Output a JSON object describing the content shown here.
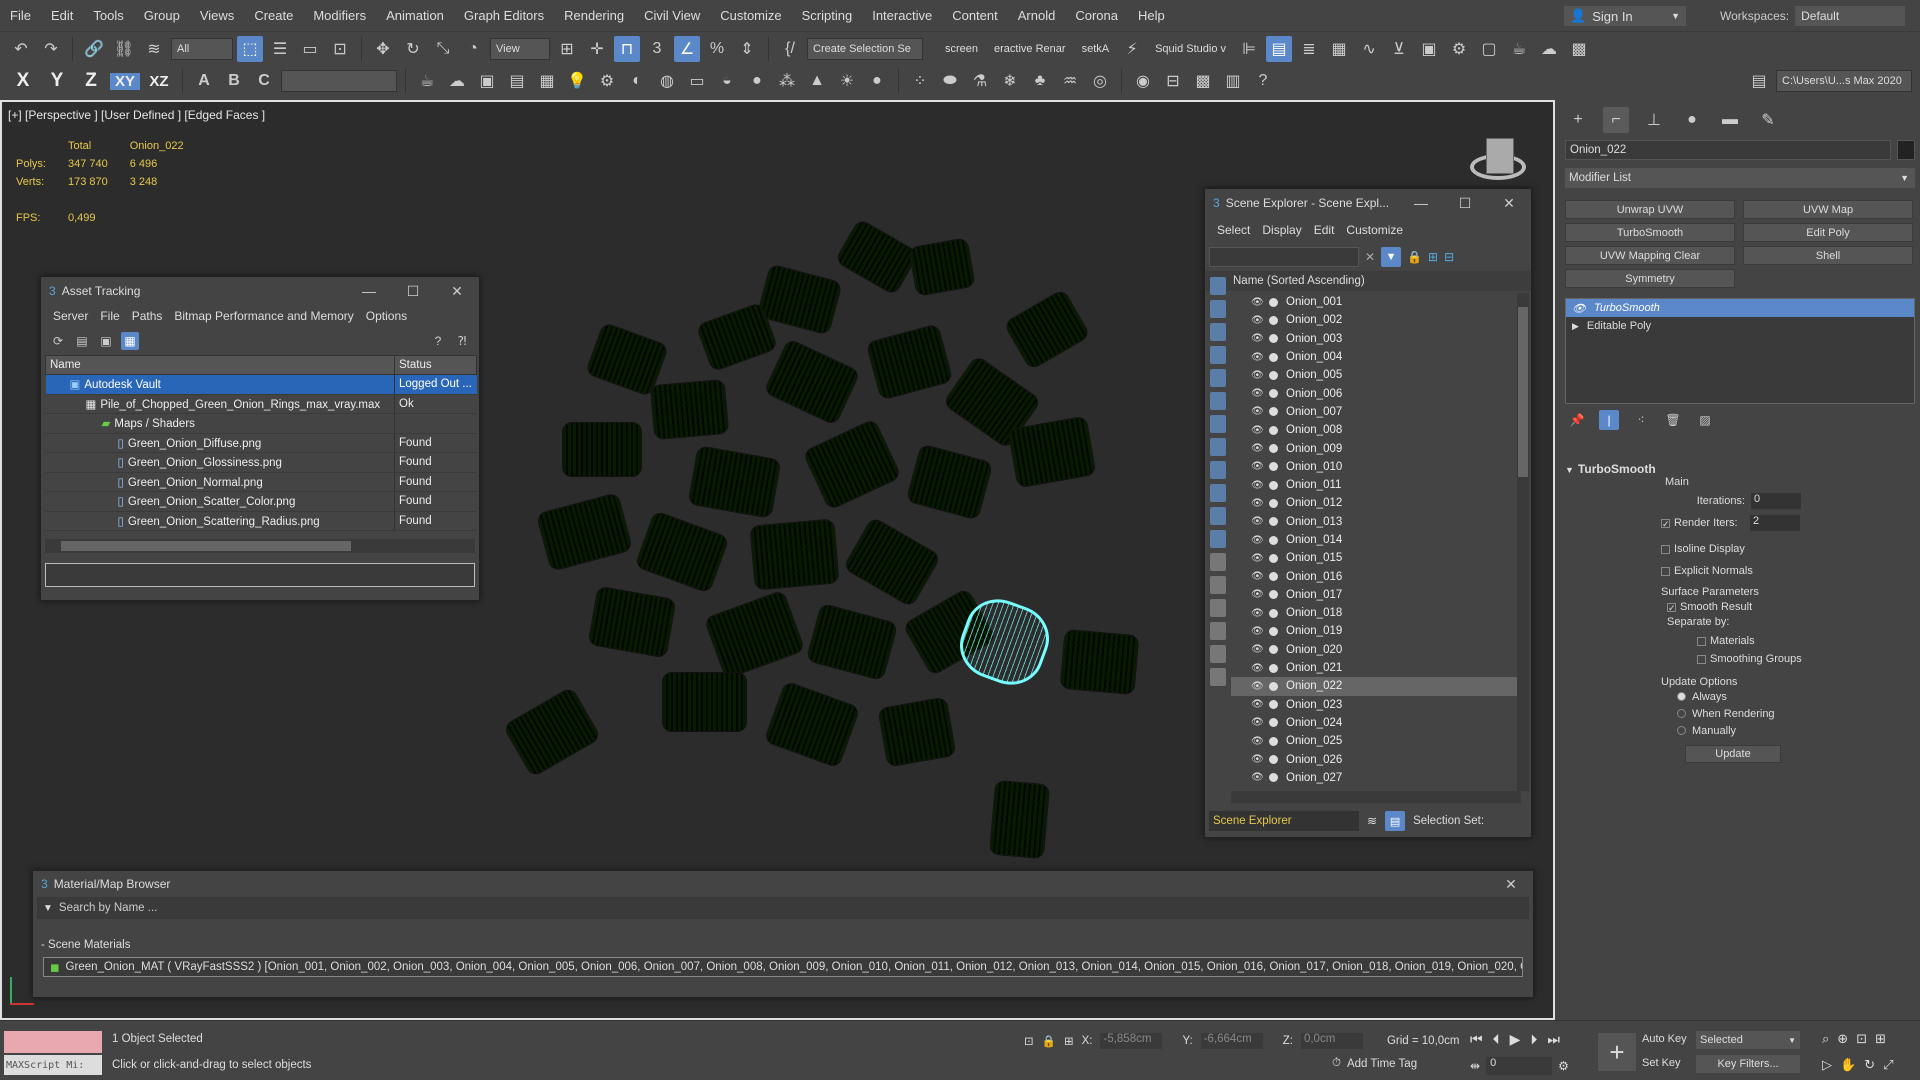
{
  "menu": [
    "File",
    "Edit",
    "Tools",
    "Group",
    "Views",
    "Create",
    "Modifiers",
    "Animation",
    "Graph Editors",
    "Rendering",
    "Civil View",
    "Customize",
    "Scripting",
    "Interactive",
    "Content",
    "Arnold",
    "Corona",
    "Help"
  ],
  "signin": "Sign In",
  "workspaces": {
    "label": "Workspaces:",
    "value": "Default"
  },
  "toolbar1": {
    "filter": "All",
    "refcoord": "View",
    "selection_set": "Create Selection Se",
    "screen_label": "screen",
    "interactive_label": "eractive Renar",
    "setka_label": "setkA",
    "squid_label": "Squid Studio v"
  },
  "toolbar2": {
    "axes": [
      "X",
      "Y",
      "Z",
      "XY",
      "XZ"
    ],
    "path": "C:\\Users\\U...s Max 2020"
  },
  "viewport": {
    "label": "[+] [Perspective ] [User Defined ] [Edged Faces ]",
    "stats": {
      "col_total": "Total",
      "col_obj": "Onion_022",
      "polys_label": "Polys:",
      "polys_total": "347 740",
      "polys_obj": "6 496",
      "verts_label": "Verts:",
      "verts_total": "173 870",
      "verts_obj": "3 248",
      "fps_label": "FPS:",
      "fps": "0,499"
    }
  },
  "asset": {
    "title": "Asset Tracking",
    "menu": [
      "Server",
      "File",
      "Paths",
      "Bitmap Performance and Memory",
      "Options"
    ],
    "col_name": "Name",
    "col_status": "Status",
    "rows": [
      {
        "name": "Autodesk Vault",
        "status": "Logged Out ..."
      },
      {
        "name": "Pile_of_Chopped_Green_Onion_Rings_max_vray.max",
        "status": "Ok"
      },
      {
        "name": "Maps / Shaders",
        "status": ""
      },
      {
        "name": "Green_Onion_Diffuse.png",
        "status": "Found"
      },
      {
        "name": "Green_Onion_Glossiness.png",
        "status": "Found"
      },
      {
        "name": "Green_Onion_Normal.png",
        "status": "Found"
      },
      {
        "name": "Green_Onion_Scatter_Color.png",
        "status": "Found"
      },
      {
        "name": "Green_Onion_Scattering_Radius.png",
        "status": "Found"
      }
    ]
  },
  "scene": {
    "title": "Scene Explorer - Scene Expl...",
    "menu": [
      "Select",
      "Display",
      "Edit",
      "Customize"
    ],
    "header": "Name (Sorted Ascending)",
    "items": [
      "Onion_001",
      "Onion_002",
      "Onion_003",
      "Onion_004",
      "Onion_005",
      "Onion_006",
      "Onion_007",
      "Onion_008",
      "Onion_009",
      "Onion_010",
      "Onion_011",
      "Onion_012",
      "Onion_013",
      "Onion_014",
      "Onion_015",
      "Onion_016",
      "Onion_017",
      "Onion_018",
      "Onion_019",
      "Onion_020",
      "Onion_021",
      "Onion_022",
      "Onion_023",
      "Onion_024",
      "Onion_025",
      "Onion_026",
      "Onion_027"
    ],
    "selected": "Onion_022",
    "footer_dropdown": "Scene Explorer",
    "selection_set": "Selection Set:"
  },
  "matbrowser": {
    "title": "Material/Map Browser",
    "search_placeholder": "Search by Name ...",
    "section": "- Scene Materials",
    "item": "Green_Onion_MAT  ( VRayFastSSS2 )  [Onion_001, Onion_002, Onion_003, Onion_004, Onion_005, Onion_006, Onion_007, Onion_008, Onion_009, Onion_010, Onion_011, Onion_012, Onion_013, Onion_014, Onion_015, Onion_016, Onion_017, Onion_018, Onion_019, Onion_020, O..."
  },
  "cmd": {
    "object_name": "Onion_022",
    "modifier_list": "Modifier List",
    "buttons": [
      "Unwrap UVW",
      "UVW Map",
      "TurboSmooth",
      "Edit Poly",
      "UVW Mapping Clear",
      "Shell",
      "Symmetry"
    ],
    "stack": [
      "TurboSmooth",
      "Editable Poly"
    ],
    "rollout_title": "TurboSmooth",
    "main_group": "Main",
    "iterations_label": "Iterations:",
    "iterations": "0",
    "render_iters_label": "Render Iters:",
    "render_iters": "2",
    "isoline": "Isoline Display",
    "explicit": "Explicit Normals",
    "surface_group": "Surface Parameters",
    "smooth_result": "Smooth Result",
    "separate_by": "Separate by:",
    "materials": "Materials",
    "smoothing_groups": "Smoothing Groups",
    "update_group": "Update Options",
    "always": "Always",
    "when_rendering": "When Rendering",
    "manually": "Manually",
    "update_button": "Update"
  },
  "status": {
    "maxscript": "MAXScript Mi:",
    "selected": "1 Object Selected",
    "prompt": "Click or click-and-drag to select objects",
    "x_label": "X:",
    "x": "-5,858cm",
    "y_label": "Y:",
    "y": "-6,664cm",
    "z_label": "Z:",
    "z": "0,0cm",
    "grid": "Grid = 10,0cm",
    "add_time_tag": "Add Time Tag",
    "auto_key": "Auto Key",
    "selected_dd": "Selected",
    "set_key": "Set Key",
    "key_filters": "Key Filters...",
    "frame": "0"
  }
}
